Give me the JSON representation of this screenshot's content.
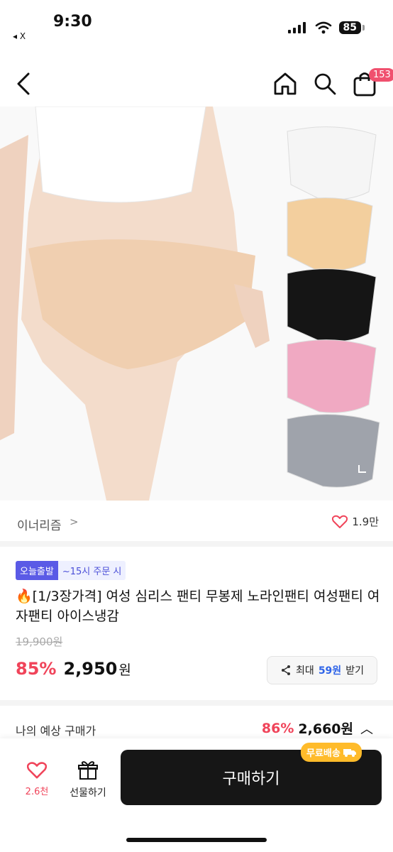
{
  "status": {
    "time": "9:30",
    "back_app": "◂ X",
    "battery": "85"
  },
  "header": {
    "cart_count": "153"
  },
  "product": {
    "brand": "이너리즘",
    "brand_chevron": ">",
    "likes": "1.9만",
    "badge_today": "오늘출발",
    "badge_time": "~15시 주문 시",
    "title": "🔥[1/3장가격] 여성 심리스 팬티 무봉제 노라인팬티 여성팬티 여자팬티 아이스냉감",
    "original_price": "19,900원",
    "discount": "85%",
    "price": "2,950",
    "won": "원",
    "coupon": {
      "prefix": "최대",
      "amount": "59원",
      "suffix": "받기"
    },
    "colors": [
      "#f5f5f5",
      "#f3cf9e",
      "#151515",
      "#f0a9c2",
      "#9fa3ab"
    ]
  },
  "estimate": {
    "label": "나의 예상 구매가",
    "discount": "86%",
    "price": "2,660원",
    "chevron": "︿"
  },
  "bottom": {
    "like_count": "2.6천",
    "gift_label": "선물하기",
    "buy_label": "구매하기",
    "free_ship": "무료배송"
  }
}
